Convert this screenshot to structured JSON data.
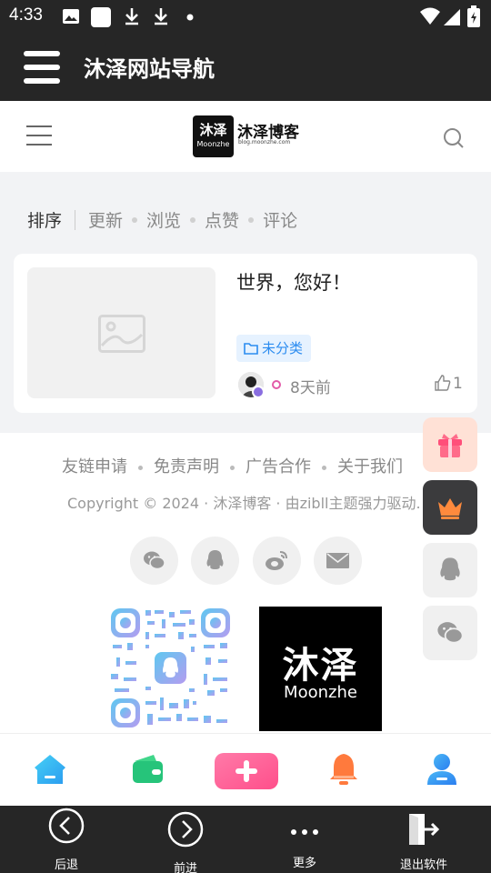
{
  "status_bar": {
    "time": "4:33"
  },
  "app_bar": {
    "title": "沐泽网站导航"
  },
  "site_header": {
    "logo_mark": "沐泽",
    "logo_mark_sub": "Moonzhe",
    "logo_brand": "沐泽博客",
    "logo_sub": "blog.moonzhe.com"
  },
  "sort": {
    "label": "排序",
    "options": [
      "更新",
      "浏览",
      "点赞",
      "评论"
    ]
  },
  "post": {
    "title": "世界，您好！",
    "category": "未分类",
    "time_ago": "8天前",
    "likes": "1"
  },
  "footer": {
    "links": [
      "友链申请",
      "免责声明",
      "广告合作",
      "关于我们"
    ],
    "copyright": "Copyright © 2024 · 沐泽博客 · 由zibll主题强力驱动.",
    "brand_cn": "沐泽",
    "brand_en": "Moonzhe"
  },
  "nav": {
    "back": "后退",
    "forward": "前进",
    "more": "更多",
    "exit": "退出软件"
  },
  "colors": {
    "dark": "#262626",
    "accent_blue": "#2b8cf0",
    "pink": "#ff5c93",
    "orange": "#ff7a45",
    "green": "#2ecc71"
  }
}
